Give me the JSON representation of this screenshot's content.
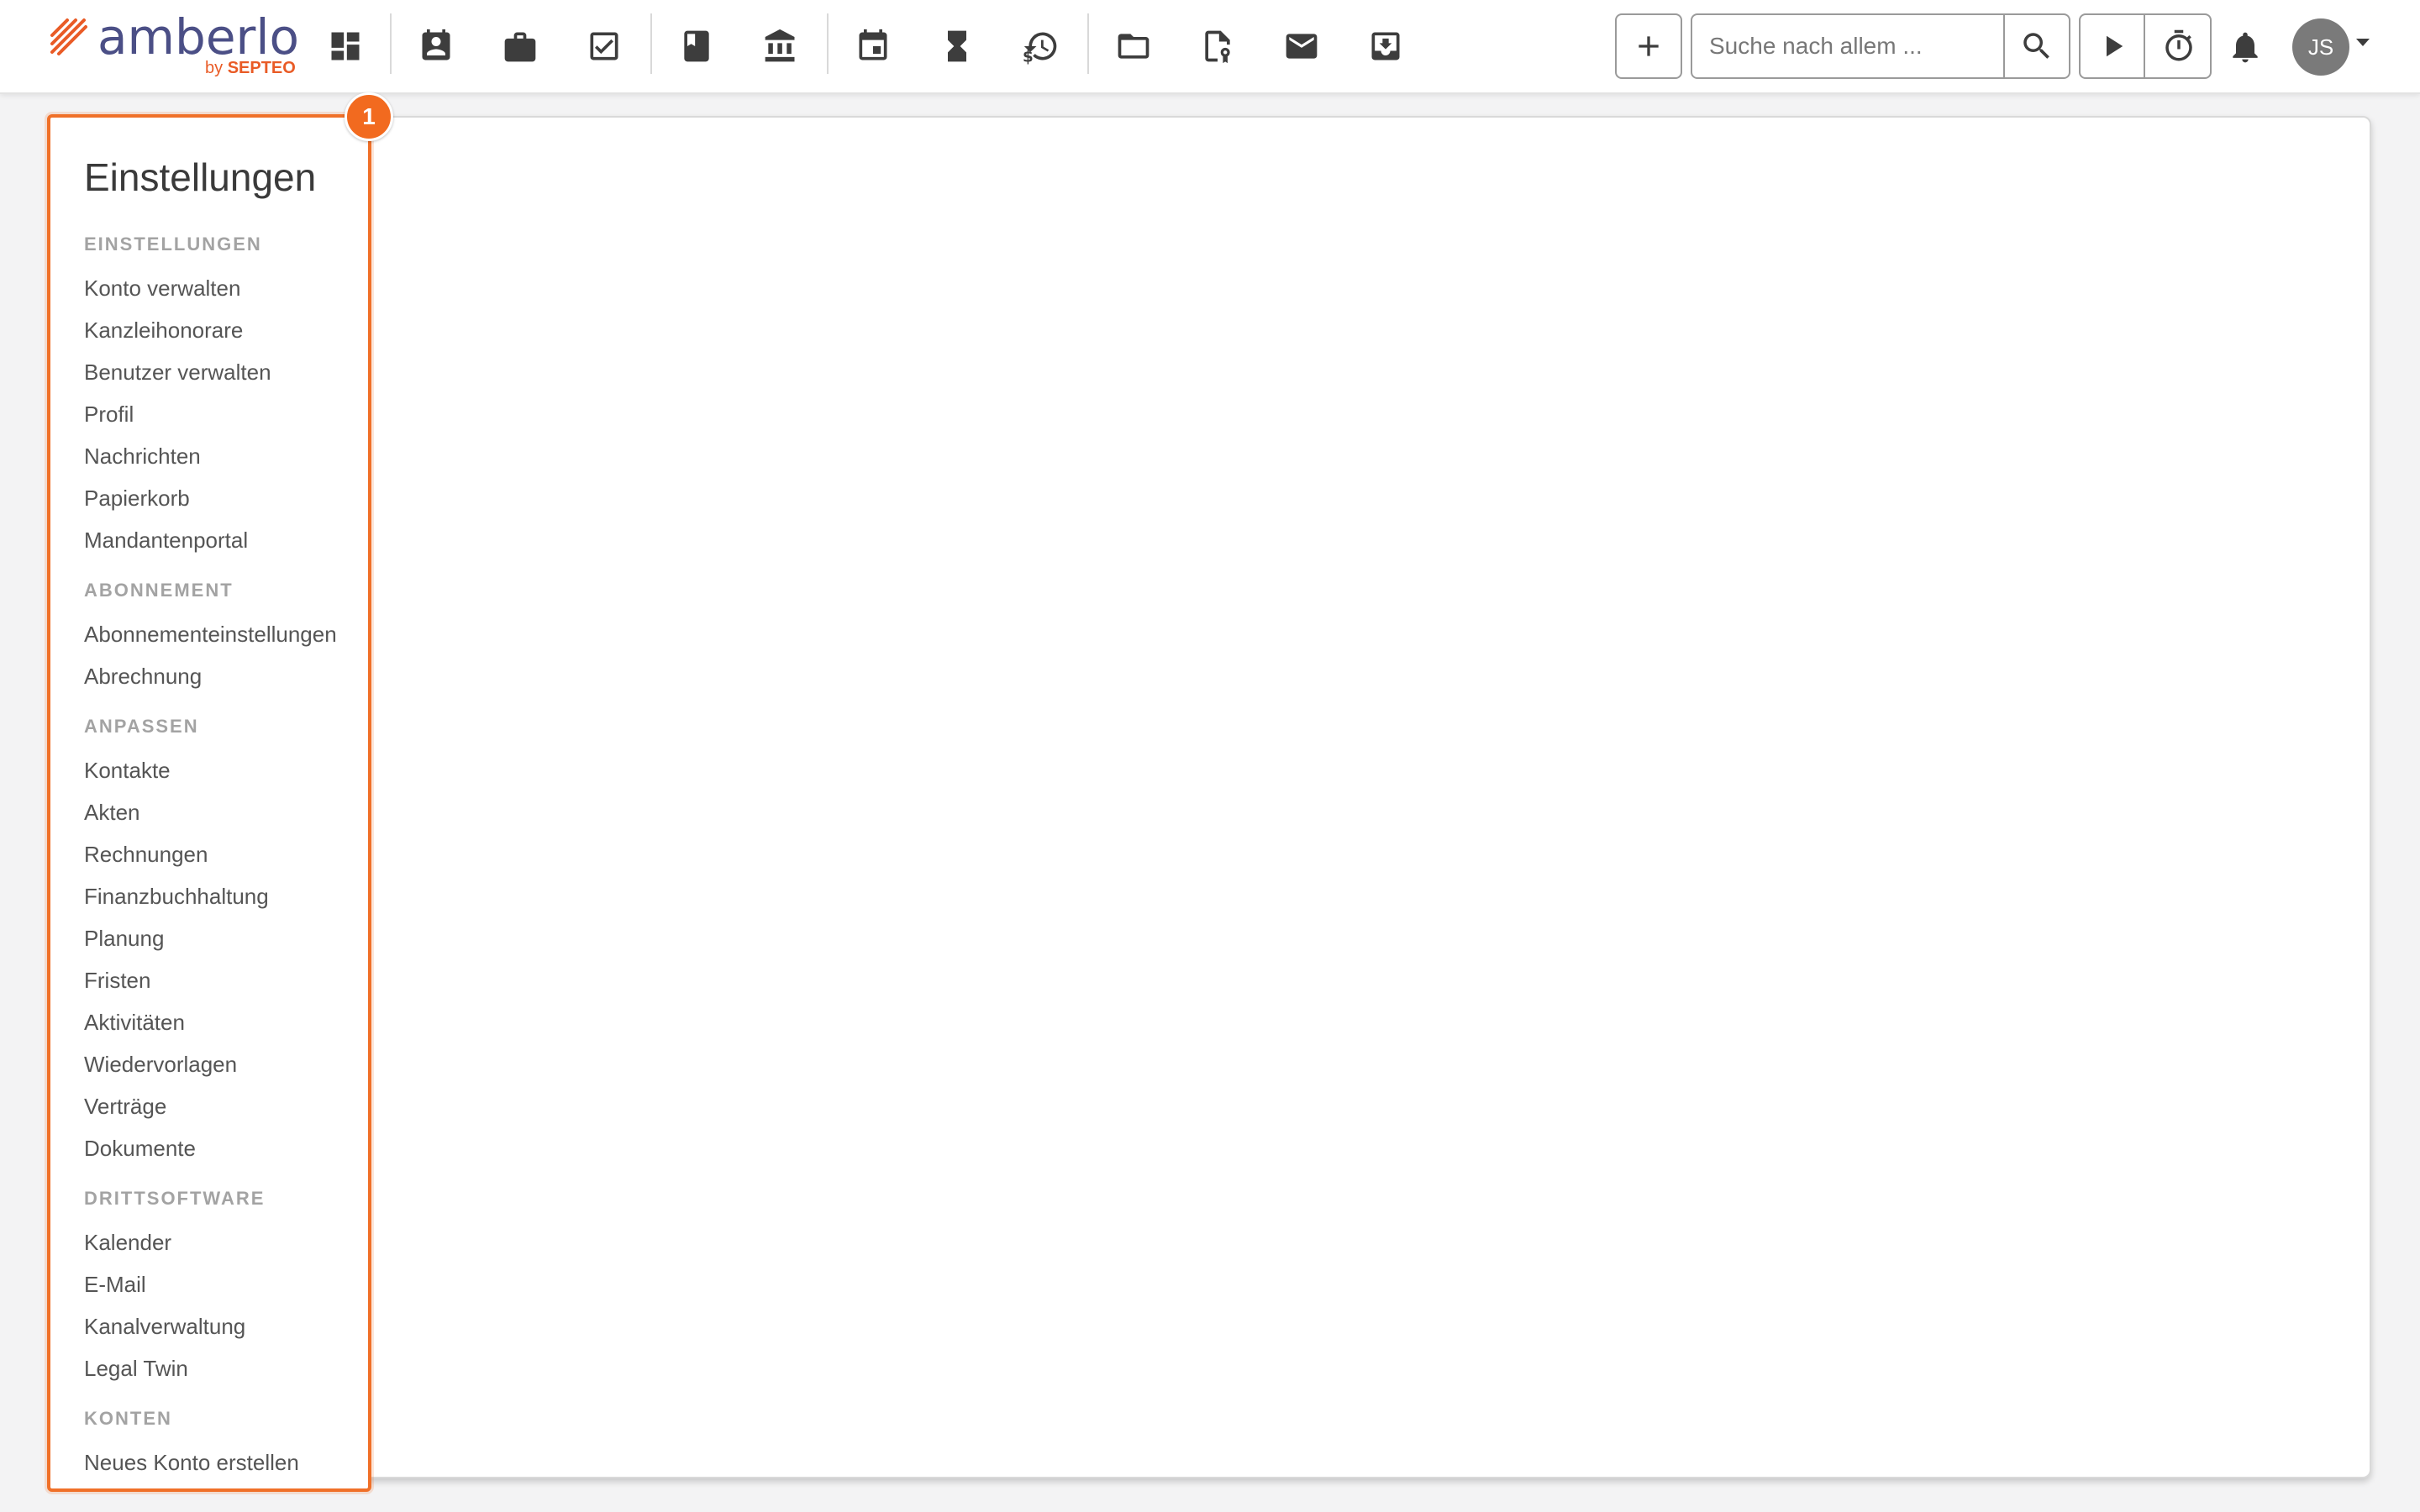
{
  "brand": {
    "name": "amberlo",
    "by_prefix": "by",
    "by_brand": "SEPTEO",
    "primary_color": "#4b4f86",
    "accent_color": "#e95b26"
  },
  "nav": {
    "icons": [
      {
        "icon": "dashboard-icon"
      },
      {
        "icon": "contacts-icon"
      },
      {
        "icon": "briefcase-icon"
      },
      {
        "icon": "tasks-check-icon"
      },
      {
        "icon": "book-icon"
      },
      {
        "icon": "bank-icon"
      },
      {
        "icon": "calendar-icon"
      },
      {
        "icon": "hourglass-icon"
      },
      {
        "icon": "billing-history-icon"
      },
      {
        "icon": "folder-icon"
      },
      {
        "icon": "contract-document-icon"
      },
      {
        "icon": "mail-icon"
      },
      {
        "icon": "inbox-download-icon"
      }
    ]
  },
  "search": {
    "placeholder": "Suche nach allem ..."
  },
  "user": {
    "initials": "JS"
  },
  "sidebar": {
    "badge": "1",
    "highlight_color": "#f07028",
    "title": "Einstellungen",
    "sections": [
      {
        "heading": "EINSTELLUNGEN",
        "items": [
          "Konto verwalten",
          "Kanzleihonorare",
          "Benutzer verwalten",
          "Profil",
          "Nachrichten",
          "Papierkorb",
          "Mandantenportal"
        ]
      },
      {
        "heading": "ABONNEMENT",
        "items": [
          "Abonnementeinstellungen",
          "Abrechnung"
        ]
      },
      {
        "heading": "ANPASSEN",
        "items": [
          "Kontakte",
          "Akten",
          "Rechnungen",
          "Finanzbuchhaltung",
          "Planung",
          "Fristen",
          "Aktivitäten",
          "Wiedervorlagen",
          "Verträge",
          "Dokumente"
        ]
      },
      {
        "heading": "DRITTSOFTWARE",
        "items": [
          "Kalender",
          "E-Mail",
          "Kanalverwaltung",
          "Legal Twin"
        ]
      },
      {
        "heading": "KONTEN",
        "items": [
          "Neues Konto erstellen"
        ]
      }
    ]
  }
}
